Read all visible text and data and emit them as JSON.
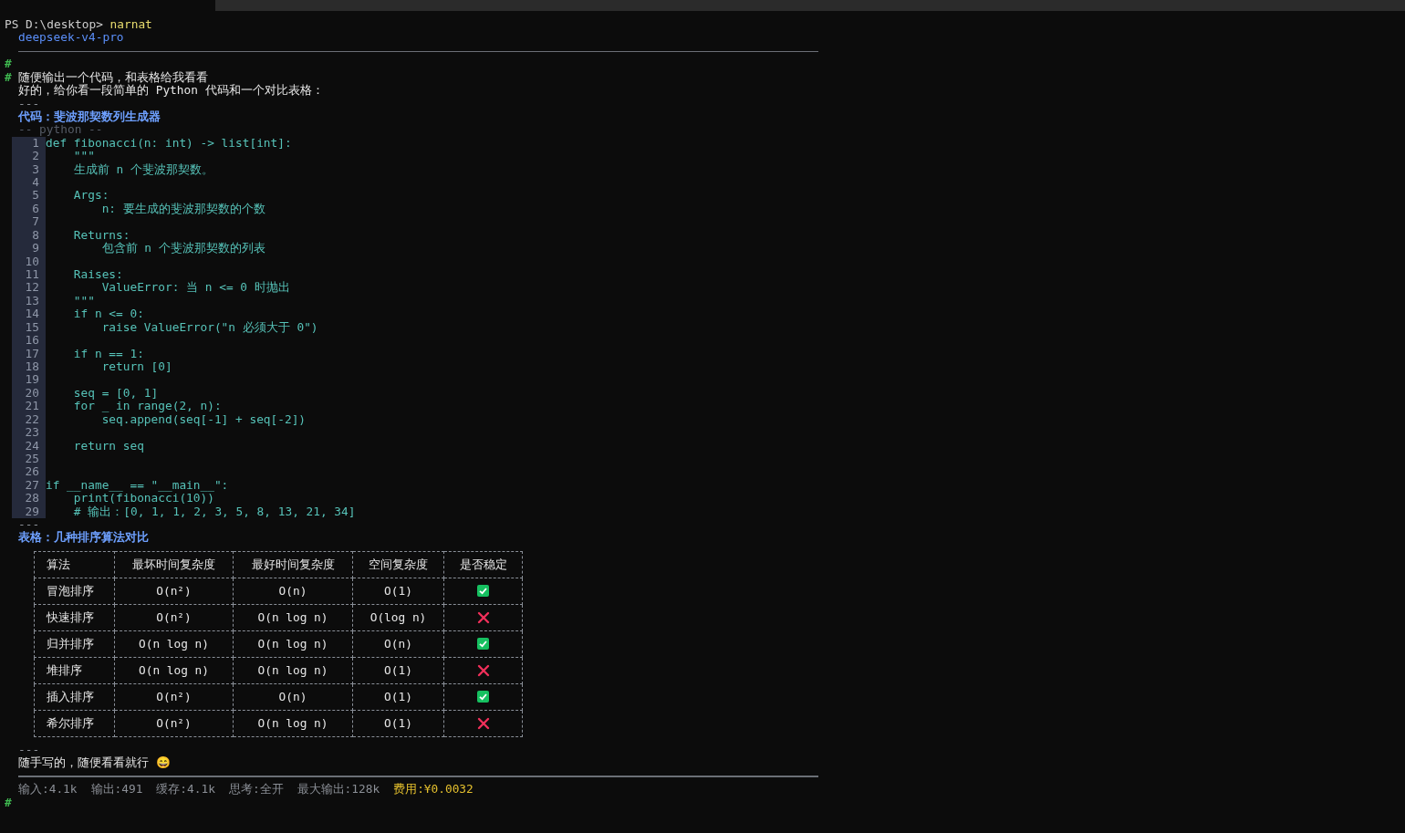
{
  "prompt": {
    "path": "PS D:\\desktop>",
    "command": "narnat"
  },
  "model": "deepseek-v4-pro",
  "user_message": {
    "marks": [
      "#",
      "#"
    ],
    "text": "随便输出一个代码，和表格给我看看"
  },
  "reply_intro": "好的，给你看一段简单的 Python 代码和一个对比表格：",
  "separator_1": "---",
  "code_heading": "代码：斐波那契数列生成器",
  "code": {
    "language_label": "-- python --",
    "lines": [
      {
        "number": "1",
        "text": "def fibonacci(n: int) -> list[int]:"
      },
      {
        "number": "2",
        "text": "    \"\"\""
      },
      {
        "number": "3",
        "text": "    生成前 n 个斐波那契数。"
      },
      {
        "number": "4"
      },
      {
        "number": "5",
        "text": "    Args:"
      },
      {
        "number": "6",
        "text": "        n: 要生成的斐波那契数的个数"
      },
      {
        "number": "7"
      },
      {
        "number": "8",
        "text": "    Returns:"
      },
      {
        "number": "9",
        "text": "        包含前 n 个斐波那契数的列表"
      },
      {
        "number": "10"
      },
      {
        "number": "11",
        "text": "    Raises:"
      },
      {
        "number": "12",
        "text": "        ValueError: 当 n <= 0 时抛出"
      },
      {
        "number": "13",
        "text": "    \"\"\""
      },
      {
        "number": "14",
        "text": "    if n <= 0:"
      },
      {
        "number": "15",
        "text": "        raise ValueError(\"n 必须大于 0\")"
      },
      {
        "number": "16"
      },
      {
        "number": "17",
        "text": "    if n == 1:"
      },
      {
        "number": "18",
        "text": "        return [0]"
      },
      {
        "number": "19"
      },
      {
        "number": "20",
        "text": "    seq = [0, 1]"
      },
      {
        "number": "21",
        "text": "    for _ in range(2, n):"
      },
      {
        "number": "22",
        "text": "        seq.append(seq[-1] + seq[-2])"
      },
      {
        "number": "23"
      },
      {
        "number": "24",
        "text": "    return seq"
      },
      {
        "number": "25"
      },
      {
        "number": "26"
      },
      {
        "number": "27",
        "text": "if __name__ == \"__main__\":"
      },
      {
        "number": "28",
        "text": "    print(fibonacci(10))"
      },
      {
        "number": "29",
        "text": "    # 输出：[0, 1, 1, 2, 3, 5, 8, 13, 21, 34]"
      }
    ]
  },
  "separator_2": "---",
  "table_heading": "表格：几种排序算法对比",
  "table": {
    "columns": [
      "算法",
      "最坏时间复杂度",
      "最好时间复杂度",
      "空间复杂度",
      "是否稳定"
    ],
    "rows": [
      {
        "cells": [
          "冒泡排序",
          "O(n²)",
          "O(n)",
          "O(1)"
        ],
        "stable": true
      },
      {
        "cells": [
          "快速排序",
          "O(n²)",
          "O(n log n)",
          "O(log n)"
        ],
        "stable": false
      },
      {
        "cells": [
          "归并排序",
          "O(n log n)",
          "O(n log n)",
          "O(n)"
        ],
        "stable": true
      },
      {
        "cells": [
          "堆排序",
          "O(n log n)",
          "O(n log n)",
          "O(1)"
        ],
        "stable": false
      },
      {
        "cells": [
          "插入排序",
          "O(n²)",
          "O(n)",
          "O(1)"
        ],
        "stable": true
      },
      {
        "cells": [
          "希尔排序",
          "O(n²)",
          "O(n log n)",
          "O(1)"
        ],
        "stable": false
      }
    ]
  },
  "separator_3": "---",
  "closing": "随手写的，随便看看就行 😄",
  "stats": [
    {
      "text": "输入:4.1k",
      "highlight": false
    },
    {
      "text": "输出:491",
      "highlight": false
    },
    {
      "text": "缓存:4.1k",
      "highlight": false
    },
    {
      "text": "思考:全开",
      "highlight": false
    },
    {
      "text": "最大输出:128k",
      "highlight": false
    },
    {
      "text": "费用:¥0.0032",
      "highlight": true
    }
  ],
  "input_mark": "#"
}
